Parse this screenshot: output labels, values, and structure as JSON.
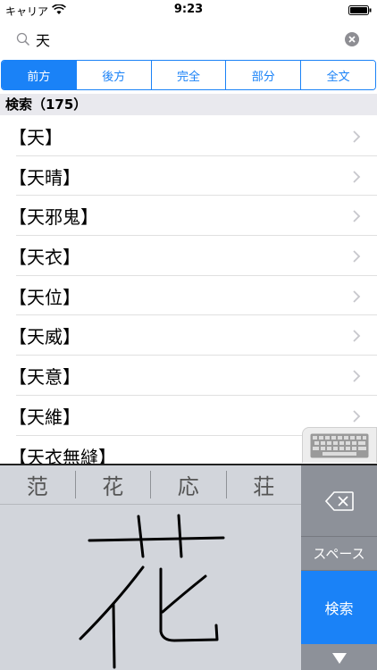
{
  "status_bar": {
    "carrier": "キャリア",
    "time": "9:23"
  },
  "search": {
    "query": "天"
  },
  "segments": [
    {
      "label": "前方",
      "selected": true
    },
    {
      "label": "後方",
      "selected": false
    },
    {
      "label": "完全",
      "selected": false
    },
    {
      "label": "部分",
      "selected": false
    },
    {
      "label": "全文",
      "selected": false
    }
  ],
  "results": {
    "header": "検索（175）",
    "items": [
      {
        "label": "【天】"
      },
      {
        "label": "【天晴】"
      },
      {
        "label": "【天邪鬼】"
      },
      {
        "label": "【天衣】"
      },
      {
        "label": "【天位】"
      },
      {
        "label": "【天威】"
      },
      {
        "label": "【天意】"
      },
      {
        "label": "【天維】"
      },
      {
        "label": "【天衣無縫】"
      }
    ]
  },
  "keyboard": {
    "candidates": [
      "范",
      "花",
      "応",
      "荘"
    ],
    "space_label": "スペース",
    "search_label": "検索"
  },
  "colors": {
    "accent": "#1a82f7",
    "keyboard_bg": "#d2d5db",
    "key_column": "#8d9199"
  }
}
